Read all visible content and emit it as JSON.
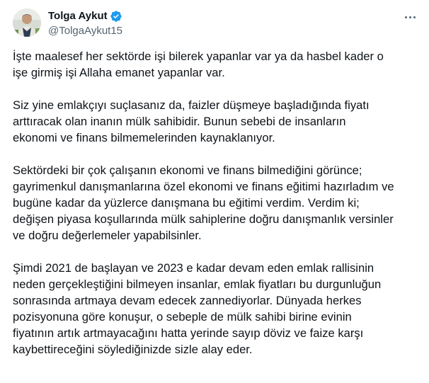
{
  "user": {
    "display_name": "Tolga Aykut",
    "handle": "@TolgaAykut15",
    "verified": true,
    "verified_color": "#1d9bf0"
  },
  "icons": {
    "verified": "verified-badge-icon",
    "more": "more-options-icon"
  },
  "tweet": {
    "paragraphs": [
      "İşte maalesef her sektörde işi bilerek yapanlar var ya da hasbel kader o\nişe girmiş işi Allaha emanet yapanlar var.",
      "Siz yine emlakçıyı suçlasanız da, faizler düşmeye başladığında fiyatı\narttıracak olan inanın mülk sahibidir. Bunun sebebi de insanların\nekonomi ve finans bilmemelerinden kaynaklanıyor.",
      "Sektördeki bir çok çalışanın ekonomi ve finans bilmediğini görünce;\ngayrimenkul danışmanlarına özel ekonomi ve finans eğitimi hazırladım ve\nbugüne kadar da yüzlerce danışmana bu eğitimi verdim. Verdim ki;\ndeğişen piyasa koşullarında mülk sahiplerine doğru danışmanlık versinler\nve doğru değerlemeler yapabilsinler.",
      "Şimdi 2021 de başlayan ve 2023 e kadar devam eden emlak rallisinin\nneden gerçekleştiğini bilmeyen insanlar, emlak fiyatları bu durgunluğun\nsonrasında artmaya devam edecek zannediyorlar. Dünyada herkes\npozisyonuna göre konuşur, o sebeple de mülk sahibi birine evinin\nfiyatının artık artmayacağını hatta yerinde sayıp döviz ve faize karşı\nkaybettireceğini söylediğinizde sizle alay eder."
    ]
  }
}
